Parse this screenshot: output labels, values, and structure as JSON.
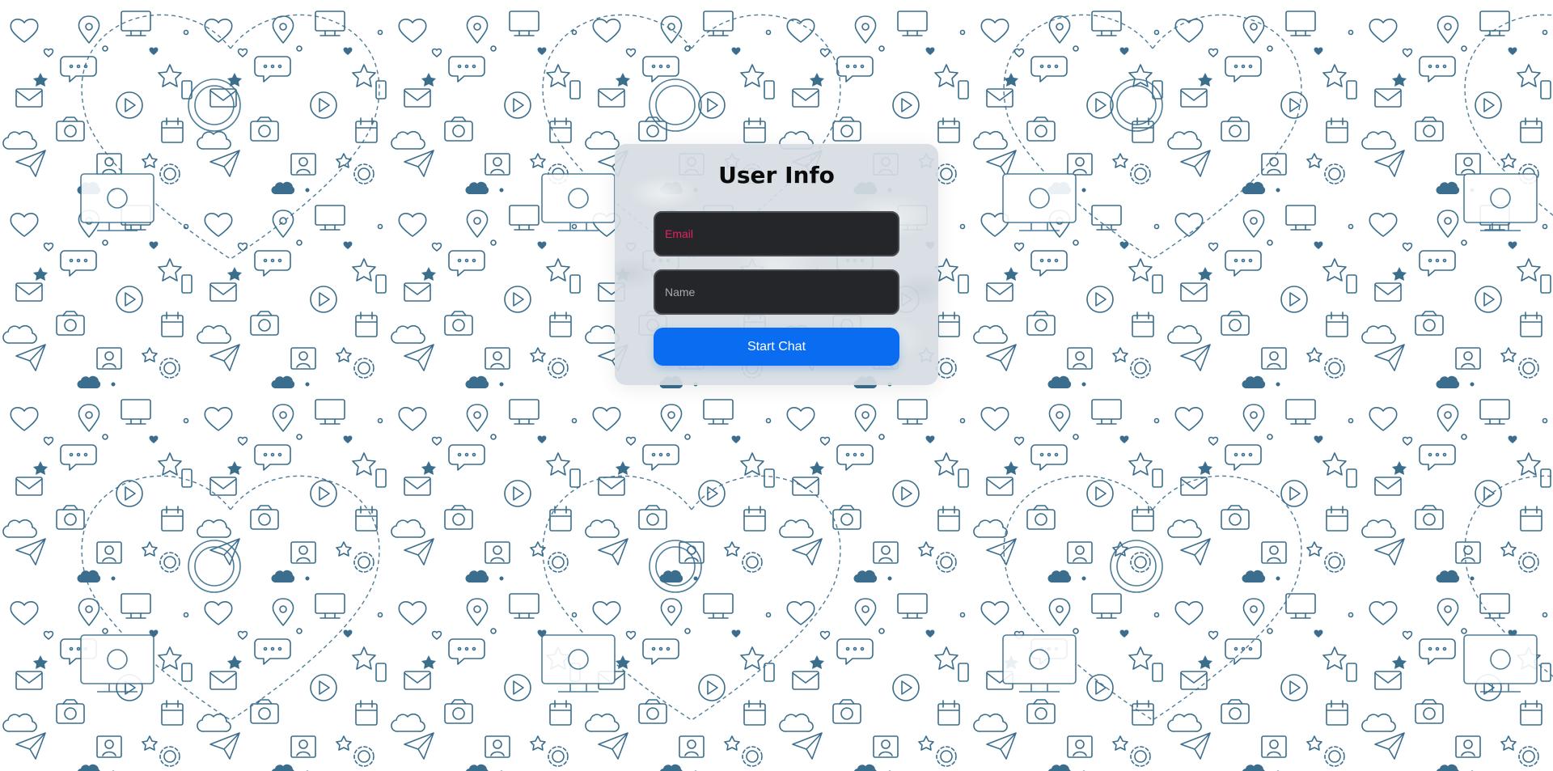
{
  "form": {
    "title": "User Info",
    "email_placeholder": "Email",
    "name_placeholder": "Name",
    "start_button_label": "Start Chat"
  },
  "background": {
    "pattern": "social-media-doodle-icons",
    "icon_color": "#3a6e8c"
  },
  "colors": {
    "button_accent": "#0a6cf0",
    "field_background": "#25262a",
    "email_placeholder_color": "#e0245e"
  }
}
